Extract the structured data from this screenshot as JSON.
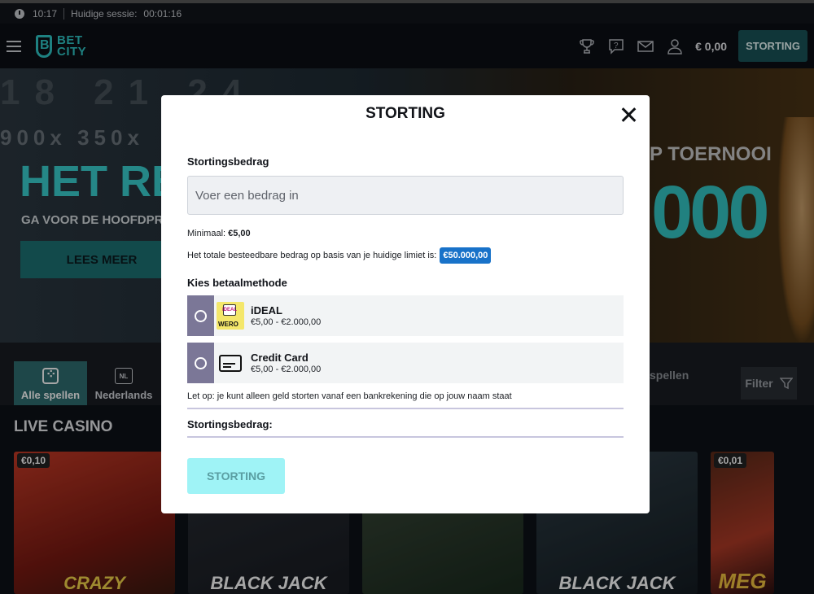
{
  "session": {
    "time": "10:17",
    "label": "Huidige sessie:",
    "duration": "00:01:16"
  },
  "header": {
    "logo_line1": "BET",
    "logo_line2": "CITY",
    "balance": "€ 0,00",
    "deposit_label": "STORTING"
  },
  "hero": {
    "numbers": "18 21 24",
    "multipliers": "900x 350x",
    "title": "HET REGEN",
    "subtitle": "GA VOOR DE HOOFDPR",
    "cta": "LEES MEER",
    "right_title": "P TOERNOOI",
    "right_big": "000"
  },
  "tabs": {
    "items": [
      {
        "label": "Alle spellen"
      },
      {
        "label": "Nederlands",
        "icon_text": "NL"
      }
    ],
    "search_label": "spellen",
    "filter_label": "Filter"
  },
  "live_casino": {
    "title": "LIVE CASINO",
    "cards": [
      {
        "chip": "€0,10",
        "brand": "CRAZY"
      },
      {
        "chip": "",
        "brand": "BLACK JACK"
      },
      {
        "chip": "",
        "brand": ""
      },
      {
        "chip": "",
        "brand": "BLACK JACK"
      },
      {
        "chip": "€0,01",
        "brand": "MEG"
      }
    ]
  },
  "modal": {
    "title": "STORTING",
    "amount_label": "Stortingsbedrag",
    "amount_placeholder": "Voer een bedrag in",
    "minimum_prefix": "Minimaal:",
    "minimum_value": "€5,00",
    "limit_text": "Het totale besteedbare bedrag op basis van je huidige limiet is:",
    "limit_value": "€50.000,00",
    "methods_label": "Kies betaalmethode",
    "methods": [
      {
        "name": "iDEAL",
        "range": "€5,00 - €2.000,00",
        "icon_name": "ideal-wero-icon",
        "icon_text": "iDEAL",
        "icon_sub": "WERO"
      },
      {
        "name": "Credit Card",
        "range": "€5,00 - €2.000,00",
        "icon_name": "credit-card-icon"
      }
    ],
    "note": "Let op: je kunt alleen geld storten vanaf een bankrekening die op jouw naam staat",
    "summary_label": "Stortingsbedrag:",
    "submit_label": "STORTING"
  }
}
